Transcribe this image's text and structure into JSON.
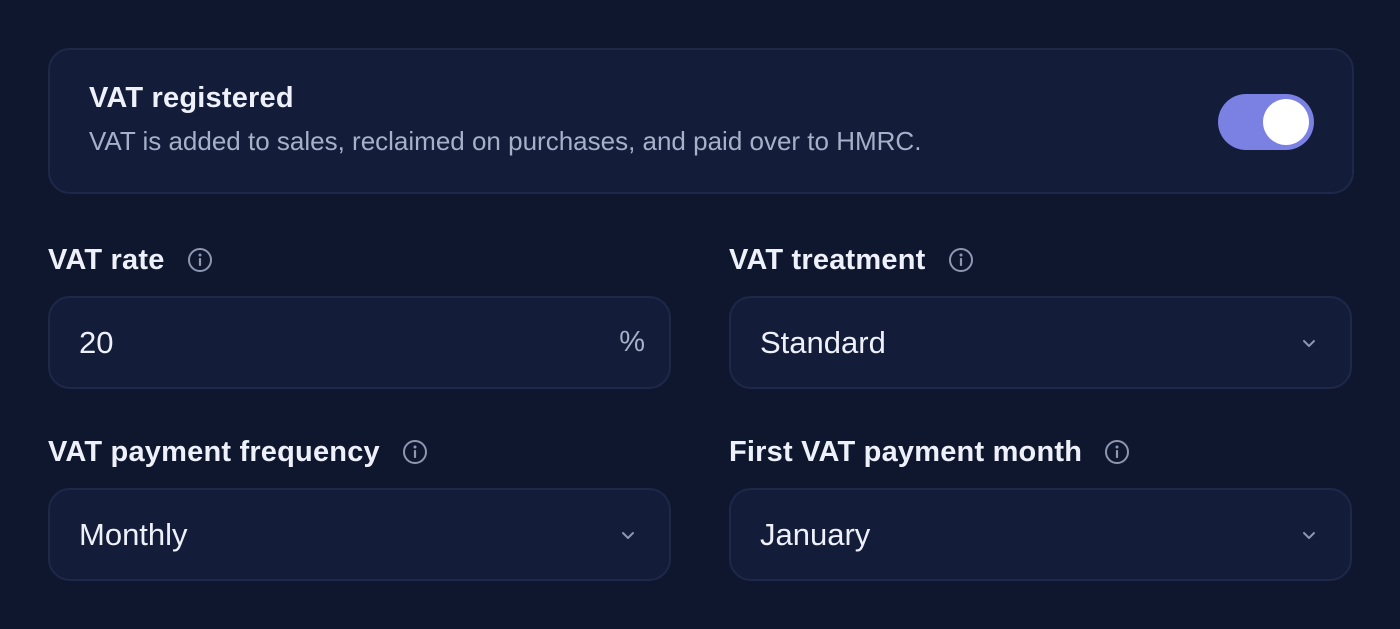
{
  "vat_registered": {
    "title": "VAT registered",
    "description": "VAT is added to sales, reclaimed on purchases, and paid over to HMRC.",
    "enabled": true
  },
  "fields": {
    "vat_rate": {
      "label": "VAT rate",
      "value": "20",
      "suffix": "%"
    },
    "vat_treatment": {
      "label": "VAT treatment",
      "value": "Standard"
    },
    "vat_payment_frequency": {
      "label": "VAT payment frequency",
      "value": "Monthly"
    },
    "first_vat_payment_month": {
      "label": "First VAT payment month",
      "value": "January"
    }
  },
  "icons": {
    "info": "info-circle-icon",
    "chevron": "chevron-down-icon"
  },
  "colors": {
    "background": "#0f172f",
    "card": "#131c38",
    "border": "#1e2848",
    "toggle_on": "#7b80e3",
    "text_primary": "#eef1fa",
    "text_secondary": "#a6b0c8"
  }
}
